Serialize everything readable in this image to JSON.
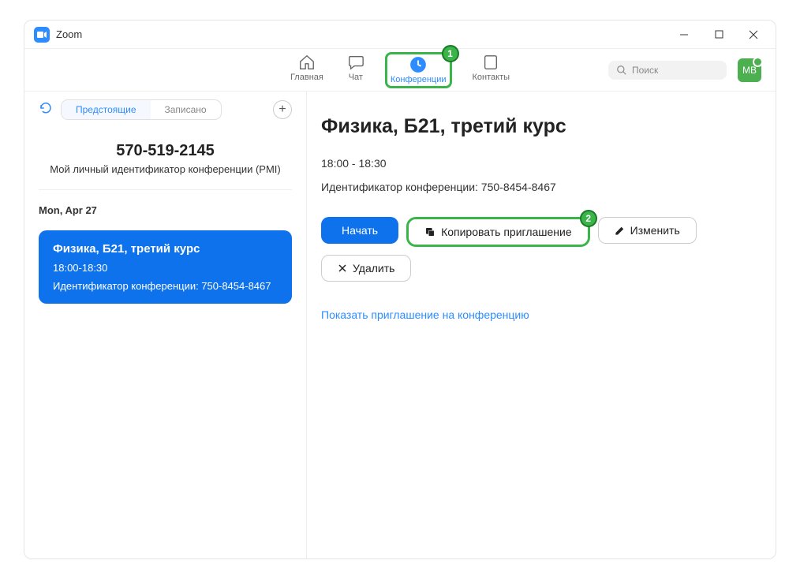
{
  "window": {
    "title": "Zoom"
  },
  "tabs": {
    "home": "Главная",
    "chat": "Чат",
    "meetings": "Конференции",
    "contacts": "Контакты"
  },
  "search": {
    "placeholder": "Поиск"
  },
  "avatar": {
    "initials": "МВ"
  },
  "sidebar": {
    "segment": {
      "upcoming": "Предстоящие",
      "recorded": "Записано"
    },
    "pmi": {
      "number": "570-519-2145",
      "label": "Мой личный идентификатор конференции (PMI)"
    },
    "date": "Mon, Apr 27",
    "meeting": {
      "title": "Физика, Б21, третий курс",
      "time": "18:00-18:30",
      "id": "Идентификатор конференции: 750-8454-8467"
    }
  },
  "detail": {
    "title": "Физика, Б21, третий курс",
    "time": "18:00 - 18:30",
    "id": "Идентификатор конференции: 750-8454-8467",
    "buttons": {
      "start": "Начать",
      "copy": "Копировать приглашение",
      "edit": "Изменить",
      "delete": "Удалить"
    },
    "show_link": "Показать приглашение на конференцию"
  },
  "annotations": {
    "one": "1",
    "two": "2"
  }
}
